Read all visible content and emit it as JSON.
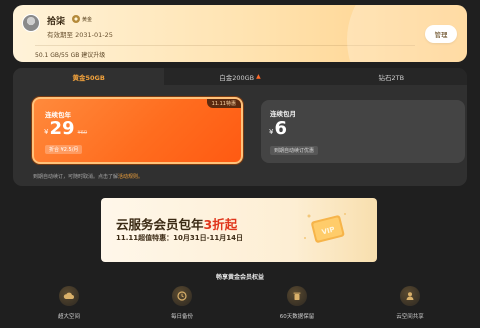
{
  "member": {
    "name": "拾柒",
    "vip_label": "黄金",
    "expire_text": "有效期至  2031-01-25",
    "storage_text": "50.1 GB/55 GB 建议升级",
    "manage_label": "管理"
  },
  "tabs": [
    {
      "label": "黄金50GB",
      "active": true
    },
    {
      "label": "白金200GB",
      "hot": true
    },
    {
      "label": "钻石2TB"
    }
  ],
  "plans": {
    "yearly": {
      "promo_tag": "11.11特惠",
      "title": "连续包年",
      "currency": "¥",
      "price": "29",
      "orig_price": "¥60",
      "monthly_chip": "折合 ¥2.5/月"
    },
    "monthly": {
      "title": "连续包月",
      "currency": "¥",
      "price": "6",
      "chip": "到期自动续订优惠"
    }
  },
  "plan_note": {
    "text": "到期自动续订，可随时取消。点击了解",
    "link": "活动规则。"
  },
  "banner": {
    "title_prefix": "云服务会员包年",
    "title_highlight": "3折起",
    "subtitle": "11.11超值特惠：10月31日-11月14日",
    "ticket_text": "VIP"
  },
  "benefits": {
    "title": "畅享黄金会员权益",
    "items": [
      {
        "label": "超大空间",
        "icon": "cloud-icon"
      },
      {
        "label": "每日备份",
        "icon": "backup-clock-icon"
      },
      {
        "label": "60天数据保留",
        "icon": "trash-restore-icon"
      },
      {
        "label": "云空间共享",
        "icon": "share-user-icon"
      }
    ]
  },
  "colors": {
    "accent": "#f2a23c",
    "plan_selected": "#ff6d1f",
    "banner_highlight": "#e0361c",
    "background": "#1f1f1f"
  }
}
